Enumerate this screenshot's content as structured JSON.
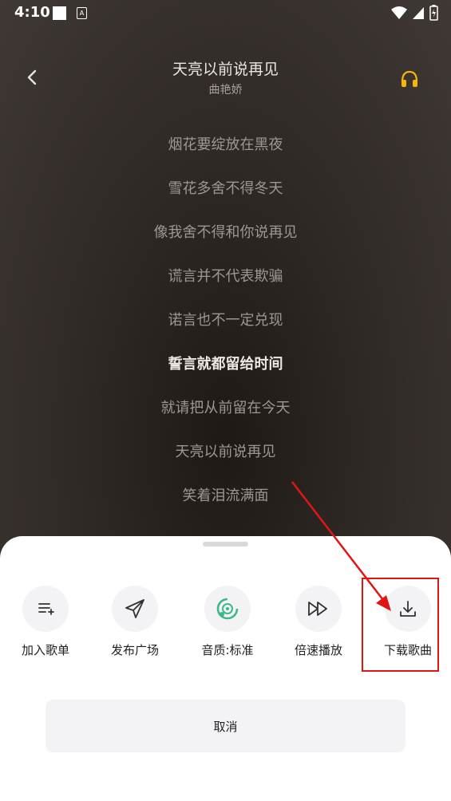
{
  "status_bar": {
    "time": "4:10",
    "badge": "A"
  },
  "header": {
    "title": "天亮以前说再见",
    "artist": "曲艳娇"
  },
  "lyrics": [
    "烟花要绽放在黑夜",
    "雪花多舍不得冬天",
    "像我舍不得和你说再见",
    "谎言并不代表欺骗",
    "诺言也不一定兑现",
    "誓言就都留给时间",
    "就请把从前留在今天",
    "天亮以前说再见",
    "笑着泪流满面"
  ],
  "active_lyric_index": 5,
  "sheet": {
    "actions": [
      {
        "label": "加入歌单",
        "icon": "add-to-playlist-icon"
      },
      {
        "label": "发布广场",
        "icon": "send-icon"
      },
      {
        "label": "音质:标准",
        "icon": "sound-quality-icon"
      },
      {
        "label": "倍速播放",
        "icon": "fast-forward-icon"
      },
      {
        "label": "下载歌曲",
        "icon": "download-icon"
      }
    ],
    "cancel_label": "取消"
  },
  "colors": {
    "accent": "#3eb88a",
    "annotation": "#e01616",
    "headphone": "#f5b800"
  }
}
